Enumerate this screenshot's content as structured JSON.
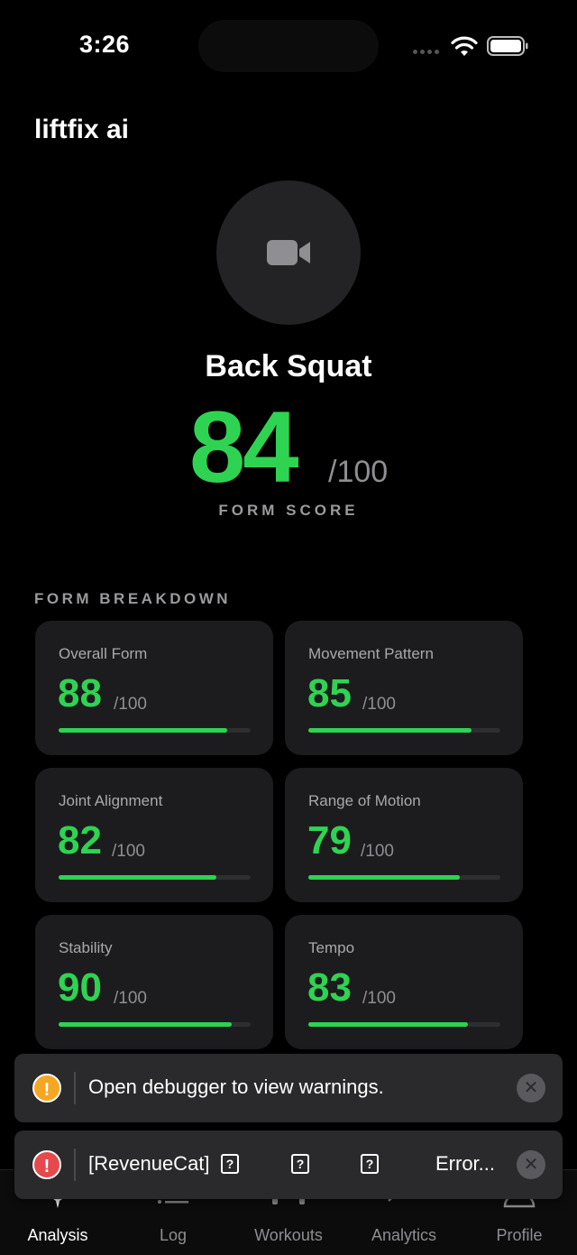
{
  "status_bar": {
    "time": "3:26"
  },
  "app": {
    "title": "liftfix ai"
  },
  "analysis": {
    "exercise_name": "Back Squat",
    "score": "84",
    "score_max": "/100",
    "score_label": "FORM SCORE",
    "breakdown_heading": "FORM BREAKDOWN",
    "metrics": [
      {
        "label": "Overall Form",
        "value": "88",
        "max": "/100",
        "progress": 0.88
      },
      {
        "label": "Movement Pattern",
        "value": "85",
        "max": "/100",
        "progress": 0.85
      },
      {
        "label": "Joint Alignment",
        "value": "82",
        "max": "/100",
        "progress": 0.82
      },
      {
        "label": "Range of Motion",
        "value": "79",
        "max": "/100",
        "progress": 0.79
      },
      {
        "label": "Stability",
        "value": "90",
        "max": "/100",
        "progress": 0.9
      },
      {
        "label": "Tempo",
        "value": "83",
        "max": "/100",
        "progress": 0.83
      }
    ]
  },
  "toasts": {
    "warning": {
      "badge": "!",
      "text": "Open debugger to view warnings.",
      "close": "✕"
    },
    "error": {
      "badge": "!",
      "text": "[RevenueCat]",
      "q": "?",
      "tail": "Error...",
      "close": "✕"
    }
  },
  "tab_bar": {
    "tabs": [
      {
        "label": "Analysis",
        "icon": "analysis-icon"
      },
      {
        "label": "Log",
        "icon": "list-icon"
      },
      {
        "label": "Workouts",
        "icon": "dumbbell-icon"
      },
      {
        "label": "Analytics",
        "icon": "chart-icon"
      },
      {
        "label": "Profile",
        "icon": "person-icon"
      }
    ]
  },
  "colors": {
    "accent": "#2fd352",
    "warning": "#f5a623",
    "error": "#e5484d"
  }
}
